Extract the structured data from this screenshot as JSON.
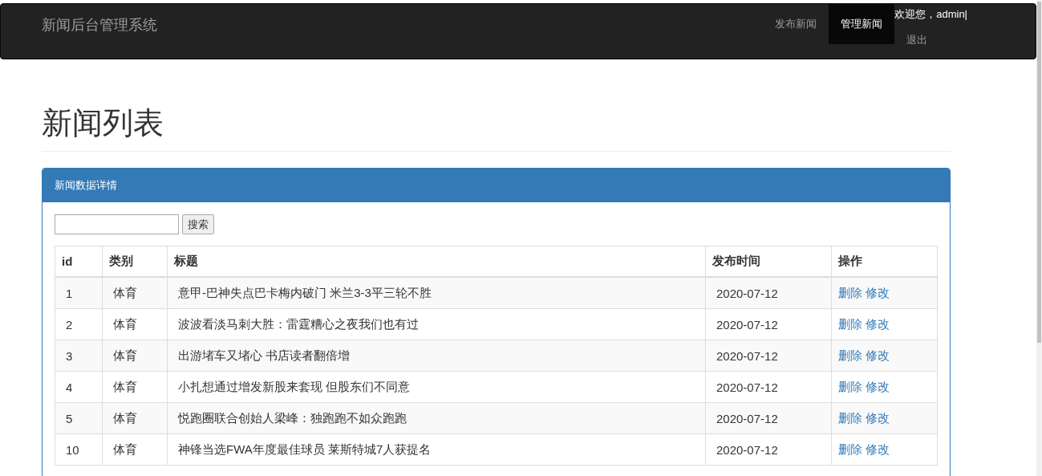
{
  "navbar": {
    "brand": "新闻后台管理系统",
    "items": [
      {
        "label": "发布新闻",
        "selected": false
      },
      {
        "label": "管理新闻",
        "selected": true
      }
    ],
    "welcome": "欢迎您，admin|",
    "logout": "退出"
  },
  "page_title": "新闻列表",
  "panel": {
    "title": "新闻数据详情",
    "search": {
      "button": "搜索"
    },
    "table": {
      "columns": [
        "id",
        "类别",
        "标题",
        "发布时间",
        "操作"
      ],
      "rows": [
        {
          "id": "1",
          "category": "体育",
          "title": "意甲-巴神失点巴卡梅内破门 米兰3-3平三轮不胜",
          "time": "2020-07-12",
          "actions": [
            "删除",
            "修改"
          ]
        },
        {
          "id": "2",
          "category": "体育",
          "title": "波波看淡马刺大胜：雷霆糟心之夜我们也有过",
          "time": "2020-07-12",
          "actions": [
            "删除",
            "修改"
          ]
        },
        {
          "id": "3",
          "category": "体育",
          "title": "出游堵车又堵心 书店读者翻倍增",
          "time": "2020-07-12",
          "actions": [
            "删除",
            "修改"
          ]
        },
        {
          "id": "4",
          "category": "体育",
          "title": "小扎想通过增发新股来套现 但股东们不同意",
          "time": "2020-07-12",
          "actions": [
            "删除",
            "修改"
          ]
        },
        {
          "id": "5",
          "category": "体育",
          "title": "悦跑圈联合创始人梁峰：独跑跑不如众跑跑",
          "time": "2020-07-12",
          "actions": [
            "删除",
            "修改"
          ]
        },
        {
          "id": "10",
          "category": "体育",
          "title": "神锋当选FWA年度最佳球员 莱斯特城7人获提名",
          "time": "2020-07-12",
          "actions": [
            "删除",
            "修改"
          ]
        }
      ]
    }
  }
}
